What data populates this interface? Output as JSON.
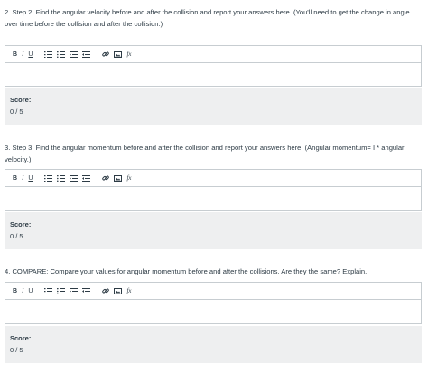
{
  "questions": [
    {
      "text": "2.  Step 2: Find the angular velocity before and after the collision and report your answers here. (You'll need to get the change in angle over time before the collision and after the collision.)",
      "score_label": "Score:",
      "score_value": "0 / 5"
    },
    {
      "text": "3.  Step 3: Find the angular momentum before and after the collision and report your answers here. (Angular momentum= I * angular velocity.)",
      "score_label": "Score:",
      "score_value": "0 / 5"
    },
    {
      "text": "4.  COMPARE: Compare your values for angular momentum before and after the collisions.  Are they the same? Explain.",
      "score_label": "Score:",
      "score_value": "0 / 5"
    }
  ],
  "toolbar": {
    "bold": "B",
    "italic": "I",
    "underline": "U",
    "formula": "fx"
  },
  "icons": [
    "bold-icon",
    "italic-icon",
    "underline-icon",
    "ordered-list-icon",
    "unordered-list-icon",
    "indent-icon",
    "outdent-icon",
    "link-icon",
    "image-icon",
    "formula-icon"
  ]
}
